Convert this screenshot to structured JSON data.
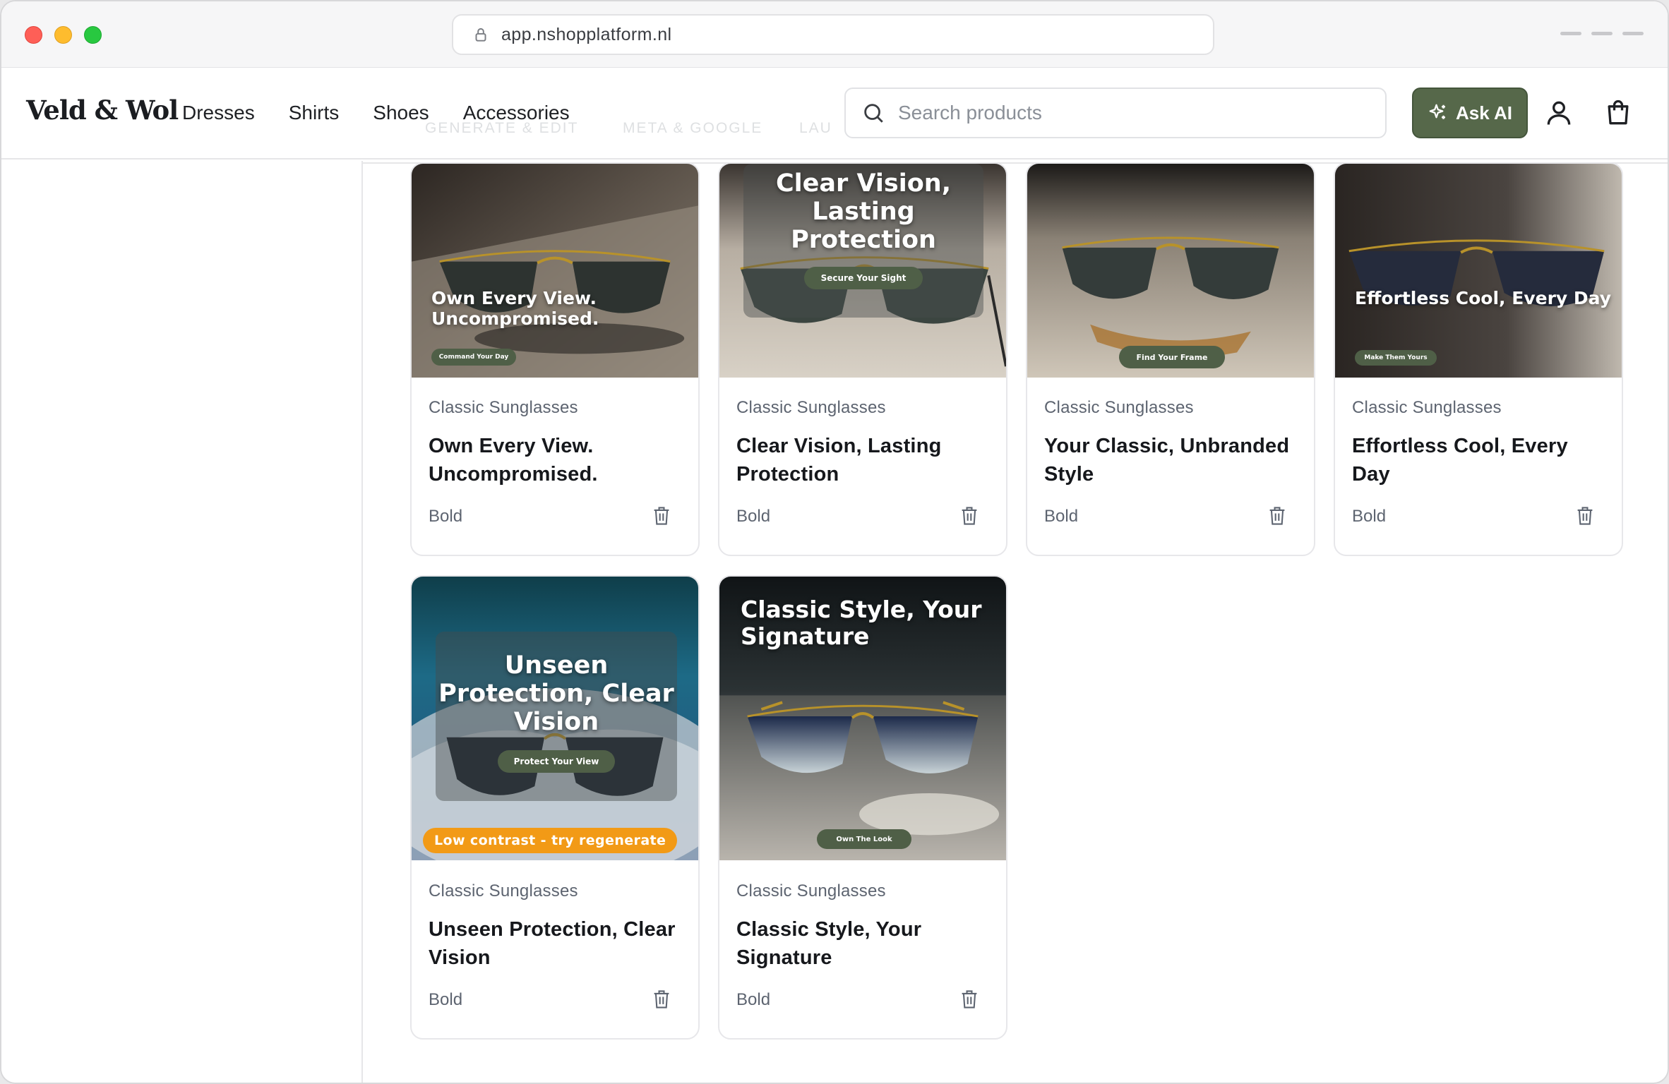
{
  "browser": {
    "url": "app.nshopplatform.nl"
  },
  "header": {
    "logo": "Veld & Wol",
    "nav": [
      "Dresses",
      "Shirts",
      "Shoes",
      "Accessories"
    ],
    "search_placeholder": "Search products",
    "ask_ai_label": "Ask AI",
    "background_tabs": [
      "GENERATE & EDIT",
      "META & GOOGLE",
      "LAU"
    ]
  },
  "cards": [
    {
      "category": "Classic Sunglasses",
      "title": "Own Every View. Uncompromised.",
      "style": "Bold",
      "ad_headline": "Own Every View. Uncompromised.",
      "ad_cta": "Command Your Day"
    },
    {
      "category": "Classic Sunglasses",
      "title": "Clear Vision, Lasting Protection",
      "style": "Bold",
      "ad_headline": "Clear Vision, Lasting Protection",
      "ad_cta": "Secure Your Sight"
    },
    {
      "category": "Classic Sunglasses",
      "title": "Your Classic, Unbranded Style",
      "style": "Bold",
      "ad_cta": "Find Your Frame"
    },
    {
      "category": "Classic Sunglasses",
      "title": "Effortless Cool, Every Day",
      "style": "Bold",
      "ad_headline": "Effortless Cool, Every Day",
      "ad_cta": "Make Them Yours"
    },
    {
      "category": "Classic Sunglasses",
      "title": "Unseen Protection, Clear Vision",
      "style": "Bold",
      "ad_headline": "Unseen Protection, Clear Vision",
      "ad_cta": "Protect Your View",
      "warning": "Low contrast - try regenerate"
    },
    {
      "category": "Classic Sunglasses",
      "title": "Classic Style, Your Signature",
      "style": "Bold",
      "ad_headline": "Classic Style, Your Signature",
      "ad_cta": "Own The Look"
    }
  ],
  "colors": {
    "accent": "#56684a",
    "warning": "#f29a16",
    "muted_text": "#5d6470"
  }
}
